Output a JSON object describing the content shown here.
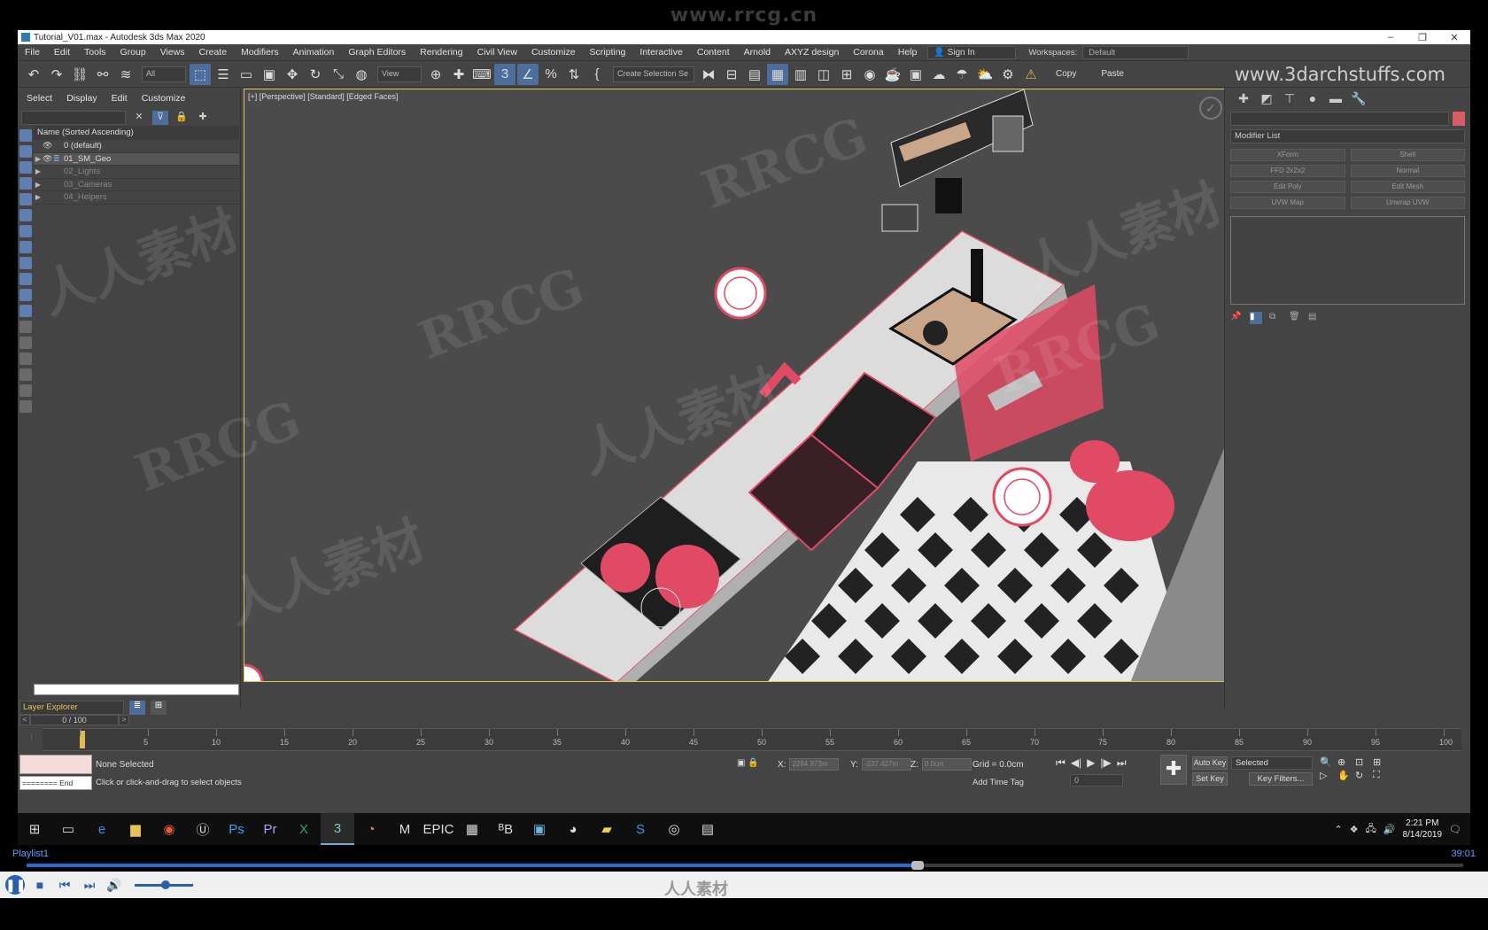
{
  "banner": {
    "text": "www.rrcg.cn"
  },
  "window": {
    "title": "Tutorial_V01.max - Autodesk 3ds Max 2020"
  },
  "menu": {
    "items": [
      "File",
      "Edit",
      "Tools",
      "Group",
      "Views",
      "Create",
      "Modifiers",
      "Animation",
      "Graph Editors",
      "Rendering",
      "Civil View",
      "Customize",
      "Scripting",
      "Interactive",
      "Content",
      "Arnold",
      "AXYZ design",
      "Corona",
      "Help"
    ],
    "sign_in": "Sign In",
    "workspaces_label": "Workspaces:",
    "workspaces_value": "Default"
  },
  "toolbar": {
    "filter": "All",
    "coord": "View",
    "selection_set": "Create Selection Se",
    "copy": "Copy",
    "paste": "Paste",
    "site_watermark": "www.3darchstuffs.com"
  },
  "explorer": {
    "menu": [
      "Select",
      "Display",
      "Edit",
      "Customize"
    ],
    "column_header": "Name (Sorted Ascending)",
    "rows": [
      {
        "label": "0 (default)",
        "expandable": false,
        "state": "normal"
      },
      {
        "label": "01_SM_Geo",
        "expandable": true,
        "state": "selected"
      },
      {
        "label": "02_Lights",
        "expandable": true,
        "state": "dim"
      },
      {
        "label": "03_Cameras",
        "expandable": true,
        "state": "dim"
      },
      {
        "label": "04_Helpers",
        "expandable": true,
        "state": "dim"
      }
    ],
    "bottom_label": "Layer Explorer"
  },
  "viewport": {
    "label": "[+] [Perspective] [Standard] [Edged Faces]"
  },
  "command_panel": {
    "modifier_list": "Modifier List",
    "buttons": [
      "XForm",
      "Shell",
      "FFD 2x2x2",
      "Normal",
      "Edit Poly",
      "Edit Mesh",
      "UVW Map",
      "Unwrap UVW"
    ]
  },
  "timeline": {
    "frame_slider": "0 / 100",
    "ticks": [
      0,
      5,
      10,
      15,
      20,
      25,
      30,
      35,
      40,
      45,
      50,
      55,
      60,
      65,
      70,
      75,
      80,
      85,
      90,
      95,
      100
    ]
  },
  "status": {
    "selection": "None Selected",
    "hint": "Click or click-and-drag to select objects",
    "maxscript_end": "======== End",
    "x_label": "X:",
    "x_value": "2284.973m",
    "y_label": "Y:",
    "y_value": "-237.427m",
    "z_label": "Z:",
    "z_value": "0.0cm",
    "grid": "Grid = 0.0cm",
    "add_time_tag": "Add Time Tag",
    "frame": "0",
    "auto_key": "Auto Key",
    "set_key": "Set Key",
    "key_mode": "Selected",
    "key_filters": "Key Filters..."
  },
  "taskbar": {
    "time": "2:21 PM",
    "date": "8/14/2019"
  },
  "player": {
    "playlist": "Playlist1",
    "time": "39:01",
    "progress": 0.62,
    "logo": "人人素材"
  },
  "watermarks": [
    "RRCG",
    "人人素材"
  ],
  "colors": {
    "accent": "#4d6e9c",
    "highlight": "#e8c15a",
    "model_red": "#e04a64"
  }
}
